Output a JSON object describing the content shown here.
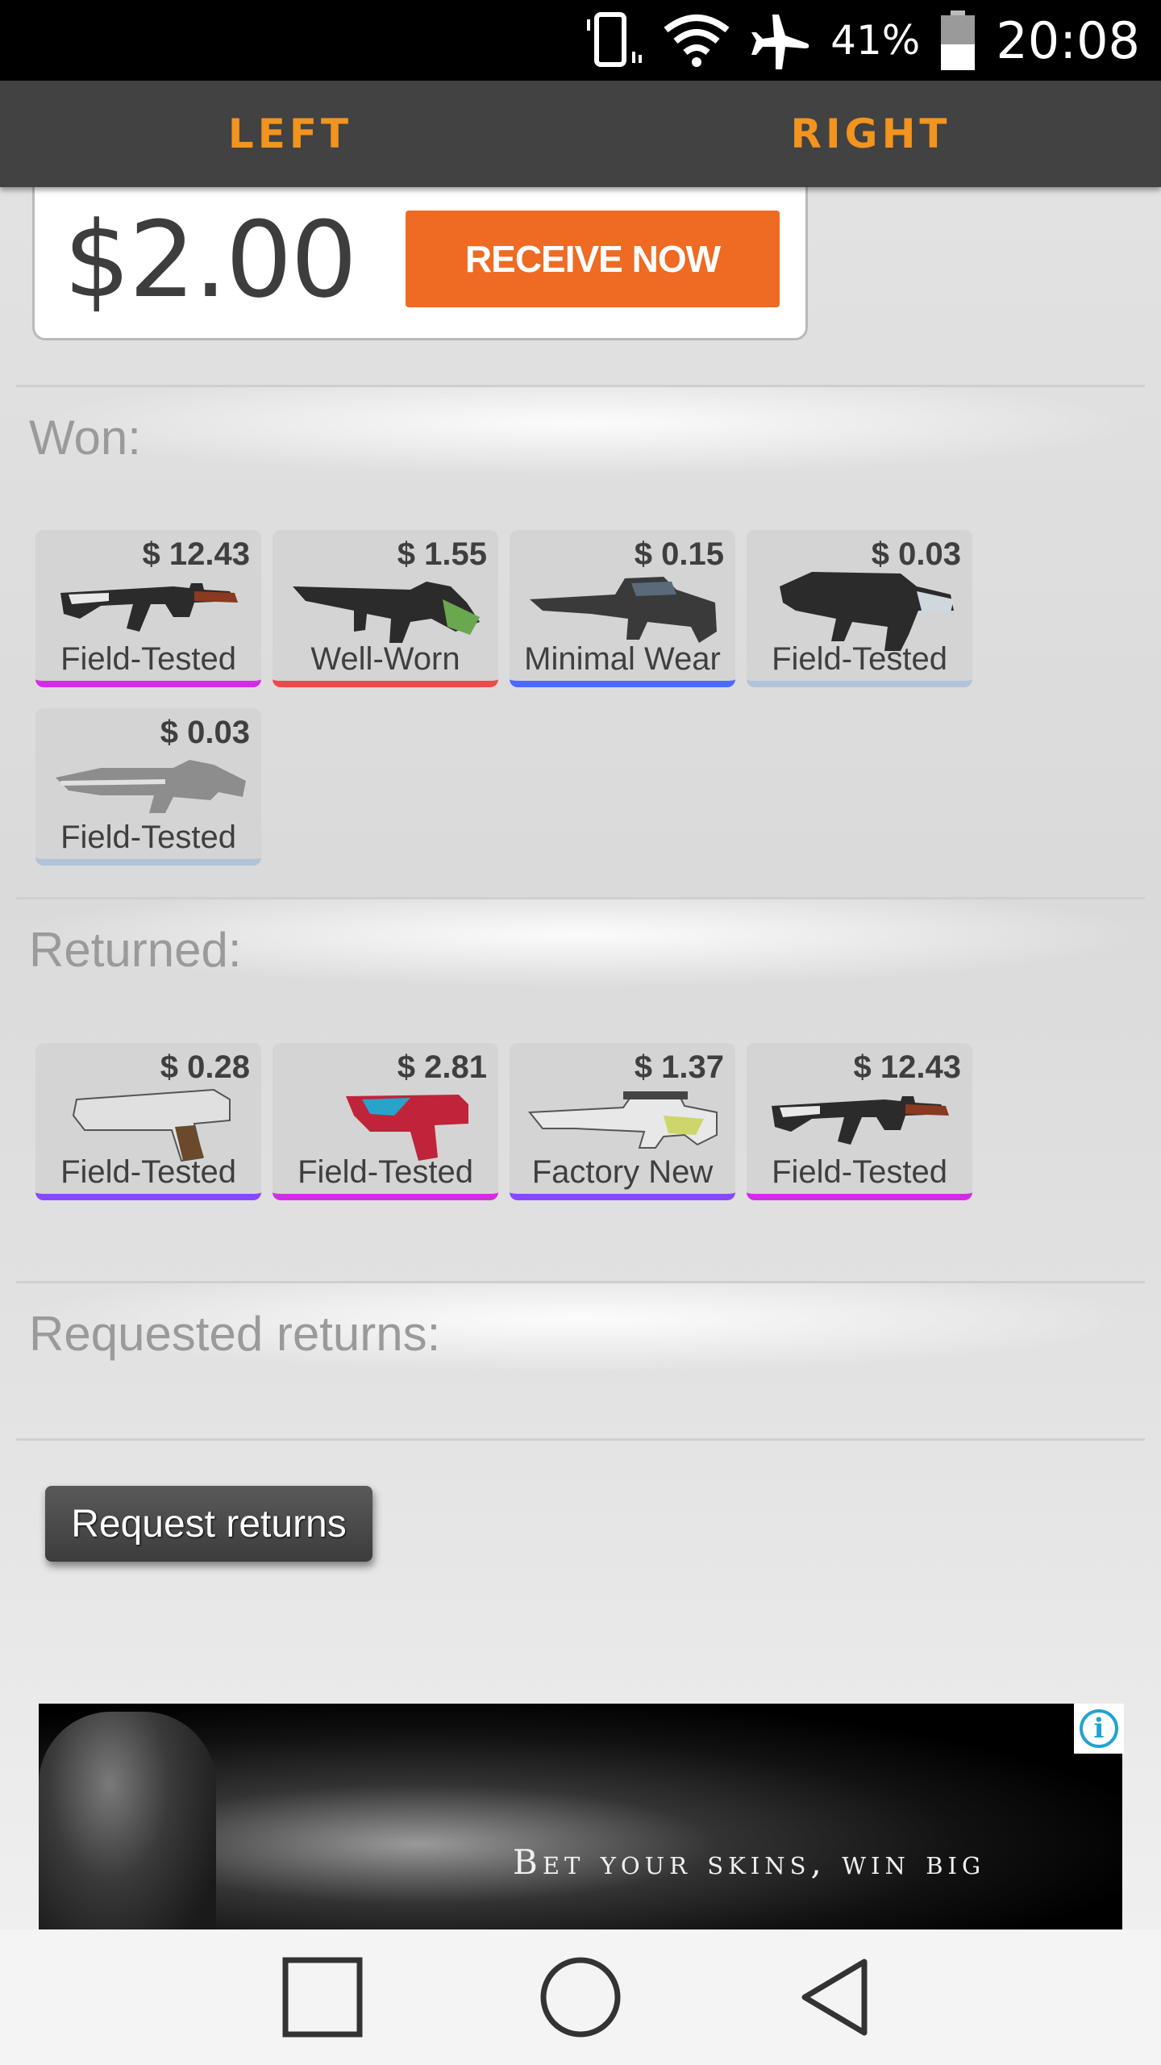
{
  "status_bar": {
    "battery_percent": "41%",
    "time": "20:08",
    "icons": [
      "vibrate-icon",
      "wifi-icon",
      "airplane-icon",
      "battery-icon"
    ]
  },
  "tabs": [
    {
      "label": "LEFT"
    },
    {
      "label": "RIGHT"
    }
  ],
  "promo": {
    "amount": "$2.00",
    "button_label": "RECEIVE NOW"
  },
  "sections": {
    "won": {
      "title": "Won:",
      "items": [
        {
          "price": "$ 12.43",
          "wear": "Field-Tested",
          "rarity_color": "#d22ce6",
          "icon": "rifle-ak-icon"
        },
        {
          "price": "$ 1.55",
          "wear": "Well-Worn",
          "rarity_color": "#eb4b4b",
          "icon": "rifle-aug-icon"
        },
        {
          "price": "$ 0.15",
          "wear": "Minimal Wear",
          "rarity_color": "#4b69ff",
          "icon": "rifle-famas-icon"
        },
        {
          "price": "$ 0.03",
          "wear": "Field-Tested",
          "rarity_color": "#b0c3d9",
          "icon": "smg-icon"
        },
        {
          "price": "$ 0.03",
          "wear": "Field-Tested",
          "rarity_color": "#b0c3d9",
          "icon": "machine-gun-icon"
        }
      ]
    },
    "returned": {
      "title": "Returned:",
      "items": [
        {
          "price": "$ 0.28",
          "wear": "Field-Tested",
          "rarity_color": "#8847ff",
          "icon": "pistol-deagle-icon"
        },
        {
          "price": "$ 2.81",
          "wear": "Field-Tested",
          "rarity_color": "#d22ce6",
          "icon": "pistol-glock-icon"
        },
        {
          "price": "$ 1.37",
          "wear": "Factory New",
          "rarity_color": "#8847ff",
          "icon": "sniper-rifle-icon"
        },
        {
          "price": "$ 12.43",
          "wear": "Field-Tested",
          "rarity_color": "#d22ce6",
          "icon": "rifle-ak-icon"
        }
      ]
    },
    "requested": {
      "title": "Requested returns:"
    }
  },
  "request_button": {
    "label": "Request returns"
  },
  "ad": {
    "text": "Bet your skins, win big"
  },
  "nav": {
    "buttons": [
      "recents-square-icon",
      "home-circle-icon",
      "back-triangle-icon"
    ]
  },
  "colors": {
    "accent_orange": "#f2941e",
    "receive_button": "#ef6a23",
    "tab_bar_bg": "#424242"
  }
}
